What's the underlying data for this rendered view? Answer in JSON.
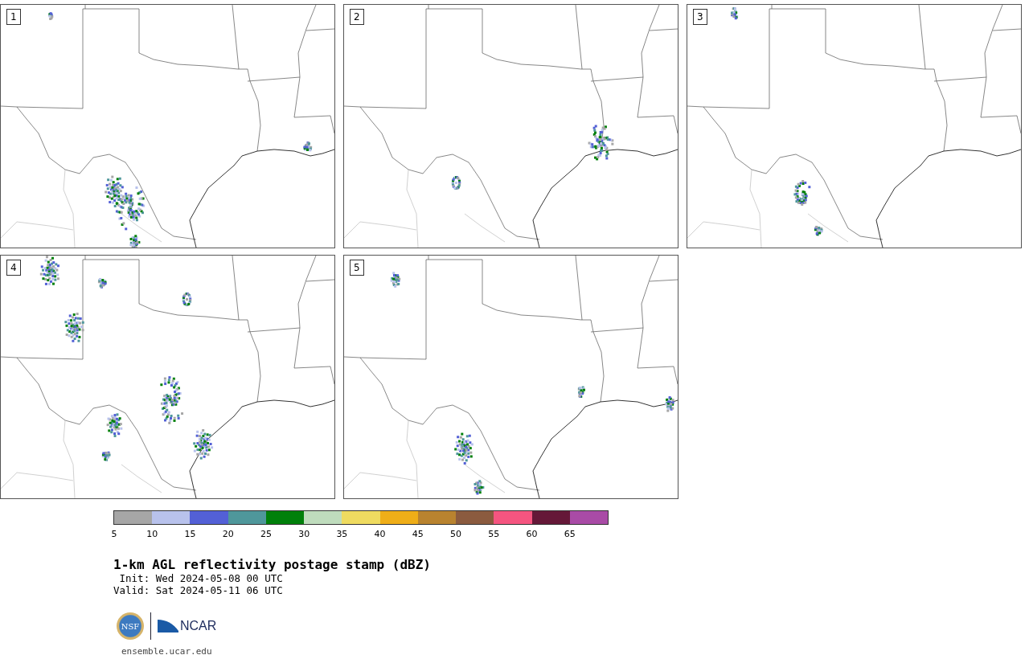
{
  "panels": [
    {
      "label": "1"
    },
    {
      "label": "2"
    },
    {
      "label": "3"
    },
    {
      "label": "4"
    },
    {
      "label": "5"
    }
  ],
  "colorbar": {
    "segments": [
      {
        "color": "#a6a6a6"
      },
      {
        "color": "#b8c2ec"
      },
      {
        "color": "#5360d6"
      },
      {
        "color": "#4f979b"
      },
      {
        "color": "#00800a"
      },
      {
        "color": "#bfdcbd"
      },
      {
        "color": "#efdb60"
      },
      {
        "color": "#efae18"
      },
      {
        "color": "#b9832f"
      },
      {
        "color": "#8b5b3f"
      },
      {
        "color": "#f55580"
      },
      {
        "color": "#651838"
      },
      {
        "color": "#a94ba6"
      }
    ],
    "ticks": [
      "5",
      "10",
      "15",
      "20",
      "25",
      "30",
      "35",
      "40",
      "45",
      "50",
      "55",
      "60",
      "65"
    ]
  },
  "title": "1-km AGL reflectivity postage stamp (dBZ)",
  "init": " Init: Wed 2024-05-08 00 UTC",
  "valid": "Valid: Sat 2024-05-11 06 UTC",
  "logos": {
    "left": "NSF",
    "right": "NCAR"
  },
  "url": "ensemble.ucar.edu"
}
